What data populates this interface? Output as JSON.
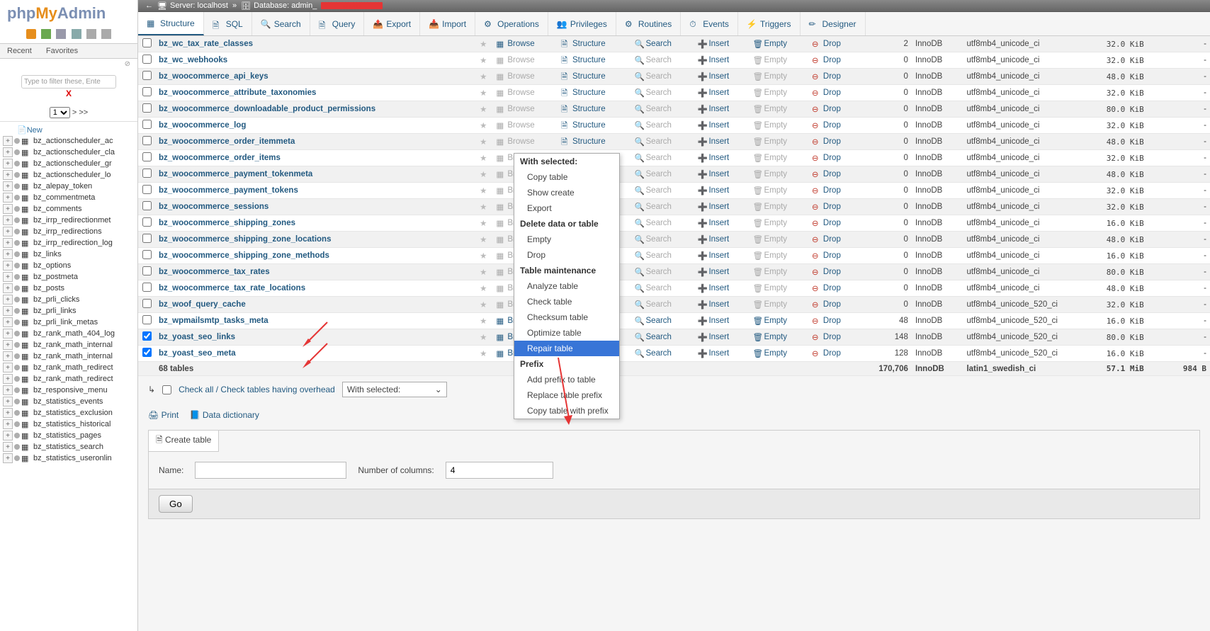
{
  "logo": {
    "php": "php",
    "my": "My",
    "admin": "Admin"
  },
  "sidebar_tabs": {
    "recent": "Recent",
    "favorites": "Favorites"
  },
  "filter": {
    "placeholder": "Type to filter these, Ente"
  },
  "pagesel": {
    "value": "1",
    "more": "> >>"
  },
  "tree": {
    "new": "New",
    "items": [
      "bz_actionscheduler_ac",
      "bz_actionscheduler_cla",
      "bz_actionscheduler_gr",
      "bz_actionscheduler_lo",
      "bz_alepay_token",
      "bz_commentmeta",
      "bz_comments",
      "bz_irrp_redirectionmet",
      "bz_irrp_redirections",
      "bz_irrp_redirection_log",
      "bz_links",
      "bz_options",
      "bz_postmeta",
      "bz_posts",
      "bz_prli_clicks",
      "bz_prli_links",
      "bz_prli_link_metas",
      "bz_rank_math_404_log",
      "bz_rank_math_internal",
      "bz_rank_math_internal",
      "bz_rank_math_redirect",
      "bz_rank_math_redirect",
      "bz_responsive_menu",
      "bz_statistics_events",
      "bz_statistics_exclusion",
      "bz_statistics_historical",
      "bz_statistics_pages",
      "bz_statistics_search",
      "bz_statistics_useronlin"
    ]
  },
  "breadcrumb": {
    "server": "Server: localhost",
    "db": "Database: admin_"
  },
  "maintabs": [
    "Structure",
    "SQL",
    "Search",
    "Query",
    "Export",
    "Import",
    "Operations",
    "Privileges",
    "Routines",
    "Events",
    "Triggers",
    "Designer"
  ],
  "actions": {
    "browse": "Browse",
    "structure": "Structure",
    "search": "Search",
    "insert": "Insert",
    "empty": "Empty",
    "drop": "Drop"
  },
  "rows": [
    {
      "name": "bz_wc_tax_rate_classes",
      "rows": 2,
      "eng": "InnoDB",
      "coll": "utf8mb4_unicode_ci",
      "size": "32.0 KiB",
      "ov": "-",
      "chk": false
    },
    {
      "name": "bz_wc_webhooks",
      "rows": 0,
      "eng": "InnoDB",
      "coll": "utf8mb4_unicode_ci",
      "size": "32.0 KiB",
      "ov": "-",
      "chk": false
    },
    {
      "name": "bz_woocommerce_api_keys",
      "rows": 0,
      "eng": "InnoDB",
      "coll": "utf8mb4_unicode_ci",
      "size": "48.0 KiB",
      "ov": "-",
      "chk": false
    },
    {
      "name": "bz_woocommerce_attribute_taxonomies",
      "rows": 0,
      "eng": "InnoDB",
      "coll": "utf8mb4_unicode_ci",
      "size": "32.0 KiB",
      "ov": "-",
      "chk": false
    },
    {
      "name": "bz_woocommerce_downloadable_product_permissions",
      "rows": 0,
      "eng": "InnoDB",
      "coll": "utf8mb4_unicode_ci",
      "size": "80.0 KiB",
      "ov": "-",
      "chk": false
    },
    {
      "name": "bz_woocommerce_log",
      "rows": 0,
      "eng": "InnoDB",
      "coll": "utf8mb4_unicode_ci",
      "size": "32.0 KiB",
      "ov": "-",
      "chk": false
    },
    {
      "name": "bz_woocommerce_order_itemmeta",
      "rows": 0,
      "eng": "InnoDB",
      "coll": "utf8mb4_unicode_ci",
      "size": "48.0 KiB",
      "ov": "-",
      "chk": false
    },
    {
      "name": "bz_woocommerce_order_items",
      "rows": 0,
      "eng": "InnoDB",
      "coll": "utf8mb4_unicode_ci",
      "size": "32.0 KiB",
      "ov": "-",
      "chk": false
    },
    {
      "name": "bz_woocommerce_payment_tokenmeta",
      "rows": 0,
      "eng": "InnoDB",
      "coll": "utf8mb4_unicode_ci",
      "size": "48.0 KiB",
      "ov": "-",
      "chk": false
    },
    {
      "name": "bz_woocommerce_payment_tokens",
      "rows": 0,
      "eng": "InnoDB",
      "coll": "utf8mb4_unicode_ci",
      "size": "32.0 KiB",
      "ov": "-",
      "chk": false
    },
    {
      "name": "bz_woocommerce_sessions",
      "rows": 0,
      "eng": "InnoDB",
      "coll": "utf8mb4_unicode_ci",
      "size": "32.0 KiB",
      "ov": "-",
      "chk": false
    },
    {
      "name": "bz_woocommerce_shipping_zones",
      "rows": 0,
      "eng": "InnoDB",
      "coll": "utf8mb4_unicode_ci",
      "size": "16.0 KiB",
      "ov": "-",
      "chk": false
    },
    {
      "name": "bz_woocommerce_shipping_zone_locations",
      "rows": 0,
      "eng": "InnoDB",
      "coll": "utf8mb4_unicode_ci",
      "size": "48.0 KiB",
      "ov": "-",
      "chk": false
    },
    {
      "name": "bz_woocommerce_shipping_zone_methods",
      "rows": 0,
      "eng": "InnoDB",
      "coll": "utf8mb4_unicode_ci",
      "size": "16.0 KiB",
      "ov": "-",
      "chk": false
    },
    {
      "name": "bz_woocommerce_tax_rates",
      "rows": 0,
      "eng": "InnoDB",
      "coll": "utf8mb4_unicode_ci",
      "size": "80.0 KiB",
      "ov": "-",
      "chk": false
    },
    {
      "name": "bz_woocommerce_tax_rate_locations",
      "rows": 0,
      "eng": "InnoDB",
      "coll": "utf8mb4_unicode_ci",
      "size": "48.0 KiB",
      "ov": "-",
      "chk": false
    },
    {
      "name": "bz_woof_query_cache",
      "rows": 0,
      "eng": "InnoDB",
      "coll": "utf8mb4_unicode_520_ci",
      "size": "32.0 KiB",
      "ov": "-",
      "chk": false
    },
    {
      "name": "bz_wpmailsmtp_tasks_meta",
      "rows": 48,
      "eng": "InnoDB",
      "coll": "utf8mb4_unicode_520_ci",
      "size": "16.0 KiB",
      "ov": "-",
      "chk": false
    },
    {
      "name": "bz_yoast_seo_links",
      "rows": 148,
      "eng": "InnoDB",
      "coll": "utf8mb4_unicode_520_ci",
      "size": "80.0 KiB",
      "ov": "-",
      "chk": true
    },
    {
      "name": "bz_yoast_seo_meta",
      "rows": 128,
      "eng": "InnoDB",
      "coll": "utf8mb4_unicode_520_ci",
      "size": "16.0 KiB",
      "ov": "-",
      "chk": true
    }
  ],
  "summary": {
    "count": "68 tables",
    "rows": "170,706",
    "eng": "InnoDB",
    "coll": "latin1_swedish_ci",
    "size": "57.1 MiB",
    "ov": "984 B"
  },
  "checkall": {
    "label": "Check all / Check tables having overhead",
    "with": "With selected:"
  },
  "ctx": {
    "hdr1": "With selected:",
    "copy": "Copy table",
    "showcreate": "Show create",
    "export": "Export",
    "hdr2": "Delete data or table",
    "empty": "Empty",
    "drop": "Drop",
    "hdr3": "Table maintenance",
    "analyze": "Analyze table",
    "check": "Check table",
    "checksum": "Checksum table",
    "optimize": "Optimize table",
    "repair": "Repair table",
    "hdr4": "Prefix",
    "addprefix": "Add prefix to table",
    "replaceprefix": "Replace table prefix",
    "copyprefix": "Copy table with prefix"
  },
  "btm": {
    "print": "Print",
    "dd": "Data dictionary"
  },
  "create": {
    "legend": "Create table",
    "name": "Name:",
    "numcol": "Number of columns:",
    "numval": "4",
    "go": "Go"
  }
}
